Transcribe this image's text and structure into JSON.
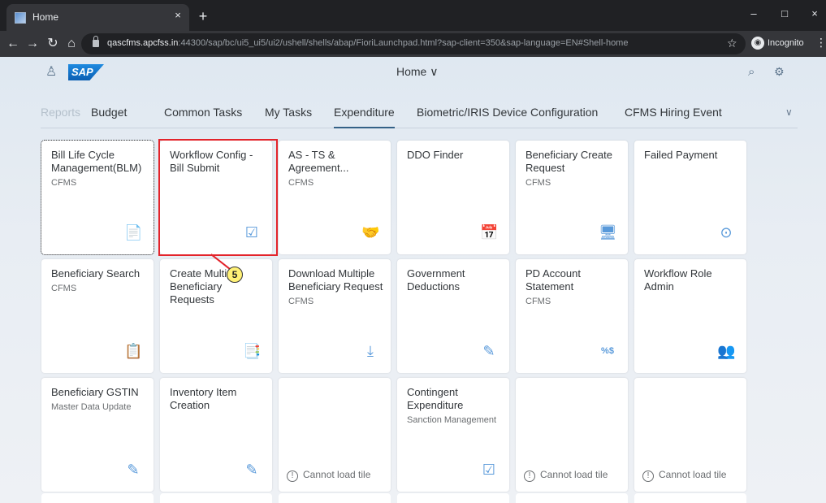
{
  "browser": {
    "tab_title": "Home",
    "tab_close": "×",
    "new_tab": "+",
    "url_host": "qascfms.apcfss.in",
    "url_rest": ":44300/sap/bc/ui5_ui5/ui2/ushell/shells/abap/FioriLaunchpad.html?sap-client=350&sap-language=EN#Shell-home",
    "incognito_label": "Incognito",
    "minimize": "–",
    "maximize": "□",
    "close": "×"
  },
  "shell": {
    "home_title": "Home ∨",
    "logo_text": "SAP"
  },
  "anchors": [
    {
      "label": "Reports"
    },
    {
      "label": "Budget"
    },
    {
      "label": "Common Tasks"
    },
    {
      "label": "My Tasks"
    },
    {
      "label": "Expenditure"
    },
    {
      "label": "Biometric/IRIS Device Configuration"
    },
    {
      "label": "CFMS Hiring Event"
    }
  ],
  "tiles": [
    {
      "title": "Bill Life Cycle Management(BLM)",
      "subtitle": "CFMS",
      "icon": "📄"
    },
    {
      "title": "Workflow Config - Bill Submit",
      "subtitle": "",
      "icon": "☑"
    },
    {
      "title": "AS - TS & Agreement...",
      "subtitle": "CFMS",
      "icon": "🤝"
    },
    {
      "title": "DDO Finder",
      "subtitle": "",
      "icon": "📅"
    },
    {
      "title": "Beneficiary Create Request",
      "subtitle": "CFMS",
      "icon": "🖥"
    },
    {
      "title": "Failed Payment",
      "subtitle": "",
      "icon": "⊙"
    },
    {
      "title": "Beneficiary Search",
      "subtitle": "CFMS",
      "icon": "📋"
    },
    {
      "title": "Create Multiple Beneficiary Requests",
      "subtitle": "",
      "icon": "📑"
    },
    {
      "title": "Download Multiple Beneficiary Request",
      "subtitle": "CFMS",
      "icon": "⤓"
    },
    {
      "title": "Government Deductions",
      "subtitle": "",
      "icon": "✎"
    },
    {
      "title": "PD Account Statement",
      "subtitle": "CFMS",
      "icon": "%$"
    },
    {
      "title": "Workflow Role Admin",
      "subtitle": "",
      "icon": "👥"
    },
    {
      "title": "Beneficiary GSTIN",
      "subtitle": "Master Data Update",
      "icon": "✎"
    },
    {
      "title": "Inventory Item Creation",
      "subtitle": "",
      "icon": "✎"
    },
    {
      "title": "",
      "subtitle": "",
      "icon": "",
      "error": "Cannot load tile"
    },
    {
      "title": "Contingent Expenditure",
      "subtitle": "Sanction Management",
      "icon": "☑"
    },
    {
      "title": "",
      "subtitle": "",
      "icon": "",
      "error": "Cannot load tile"
    },
    {
      "title": "",
      "subtitle": "",
      "icon": "",
      "error": "Cannot load tile"
    }
  ],
  "callout_number": "5"
}
